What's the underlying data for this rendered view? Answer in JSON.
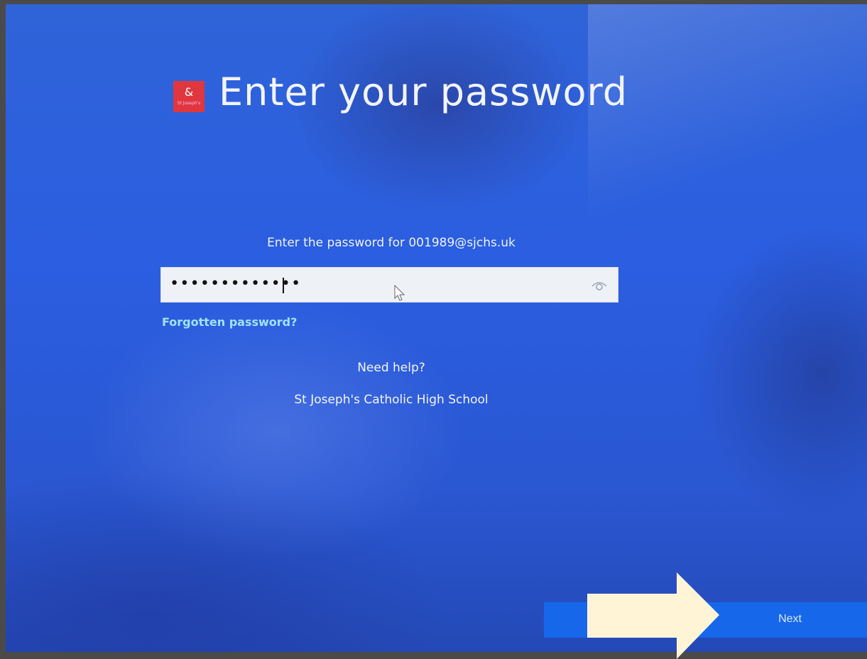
{
  "page": {
    "title": "Enter your password",
    "logo_text": "St Joseph's"
  },
  "form": {
    "prompt": "Enter the password for 001989@sjchs.uk",
    "password_value": "•••••••••••••",
    "forgot_link": "Forgotten password?"
  },
  "footer": {
    "help_link": "Need help?",
    "organization": "St Joseph's Catholic High School"
  },
  "actions": {
    "next_label": "Next"
  },
  "colors": {
    "background": "#2b5ee0",
    "logo": "#e0363e",
    "link": "#9fe3ff",
    "next_button": "#1667ea",
    "annotation_arrow": "#fff5d6"
  },
  "icons": {
    "reveal_password": "eye-icon",
    "pointer": "mouse-cursor-icon",
    "annotation": "arrow-right-icon"
  }
}
